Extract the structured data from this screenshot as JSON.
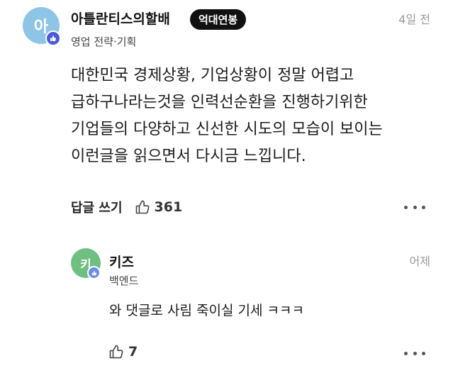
{
  "comment": {
    "avatar_initial": "아",
    "author": "아틀란티스의할배",
    "badge": "억대연봉",
    "role": "영업 전략·기획",
    "time": "4일 전",
    "body_lines": [
      "대한민국 경제상황, 기업상황이 정말 어렵고",
      "급하구나라는것을 인력선순환을 진행하기위한",
      "기업들의 다양하고 신선한 시도의 모습이 보이는",
      "이런글을 읽으면서 다시금 느낍니다."
    ],
    "reply_label": "답글 쓰기",
    "like_count": "361"
  },
  "reply": {
    "avatar_initial": "키",
    "author": "키즈",
    "role": "백엔드",
    "time": "어제",
    "body": "와 댓글로 사림 죽이실 기세 ㅋㅋㅋ",
    "like_count": "7"
  },
  "icons": {
    "verified": "thumbs-up-badge-icon",
    "like": "thumbs-up-icon",
    "more": "more-horizontal-icon"
  },
  "colors": {
    "main_avatar": "#8ec5e6",
    "reply_avatar": "#6fbf82",
    "badge_blue": "#4a5bd8",
    "pill_bg": "#111111"
  }
}
